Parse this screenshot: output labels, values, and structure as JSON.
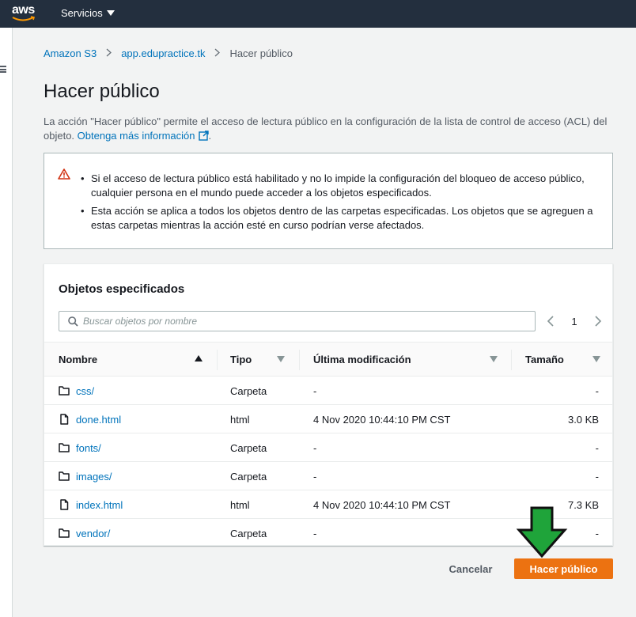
{
  "nav": {
    "logo_text": "aws",
    "services_label": "Servicios"
  },
  "breadcrumb": {
    "items": [
      "Amazon S3",
      "app.edupractice.tk"
    ],
    "current": "Hacer público"
  },
  "page": {
    "title": "Hacer público",
    "description_prefix": "La acción \"Hacer público\" permite el acceso de lectura público en la configuración de la lista de control de acceso (ACL) del objeto. ",
    "learn_more_link": "Obtenga más información",
    "description_suffix": "."
  },
  "alert": {
    "icon": "warning-icon",
    "bullets": [
      "Si el acceso de lectura público está habilitado y no lo impide la configuración del bloqueo de acceso público, cualquier persona en el mundo puede acceder a los objetos especificados.",
      "Esta acción se aplica a todos los objetos dentro de las carpetas especificadas. Los objetos que se agreguen a estas carpetas mientras la acción esté en curso podrían verse afectados."
    ]
  },
  "objects_panel": {
    "title": "Objetos especificados",
    "search_placeholder": "Buscar objetos por nombre",
    "page_number": "1",
    "columns": {
      "name": "Nombre",
      "type": "Tipo",
      "modified": "Última modificación",
      "size": "Tamaño"
    },
    "rows": [
      {
        "name": "css/",
        "type": "Carpeta",
        "modified": "-",
        "size": "-",
        "icon": "folder-icon"
      },
      {
        "name": "done.html",
        "type": "html",
        "modified": "4 Nov 2020 10:44:10 PM CST",
        "size": "3.0 KB",
        "icon": "file-icon"
      },
      {
        "name": "fonts/",
        "type": "Carpeta",
        "modified": "-",
        "size": "-",
        "icon": "folder-icon"
      },
      {
        "name": "images/",
        "type": "Carpeta",
        "modified": "-",
        "size": "-",
        "icon": "folder-icon"
      },
      {
        "name": "index.html",
        "type": "html",
        "modified": "4 Nov 2020 10:44:10 PM CST",
        "size": "7.3 KB",
        "icon": "file-icon"
      },
      {
        "name": "vendor/",
        "type": "Carpeta",
        "modified": "-",
        "size": "-",
        "icon": "folder-icon"
      }
    ]
  },
  "footer": {
    "cancel_label": "Cancelar",
    "confirm_label": "Hacer público"
  },
  "colors": {
    "nav_bg": "#232f3e",
    "link": "#0073bb",
    "primary": "#ec7211",
    "annotation_arrow": "#1fa43a"
  }
}
